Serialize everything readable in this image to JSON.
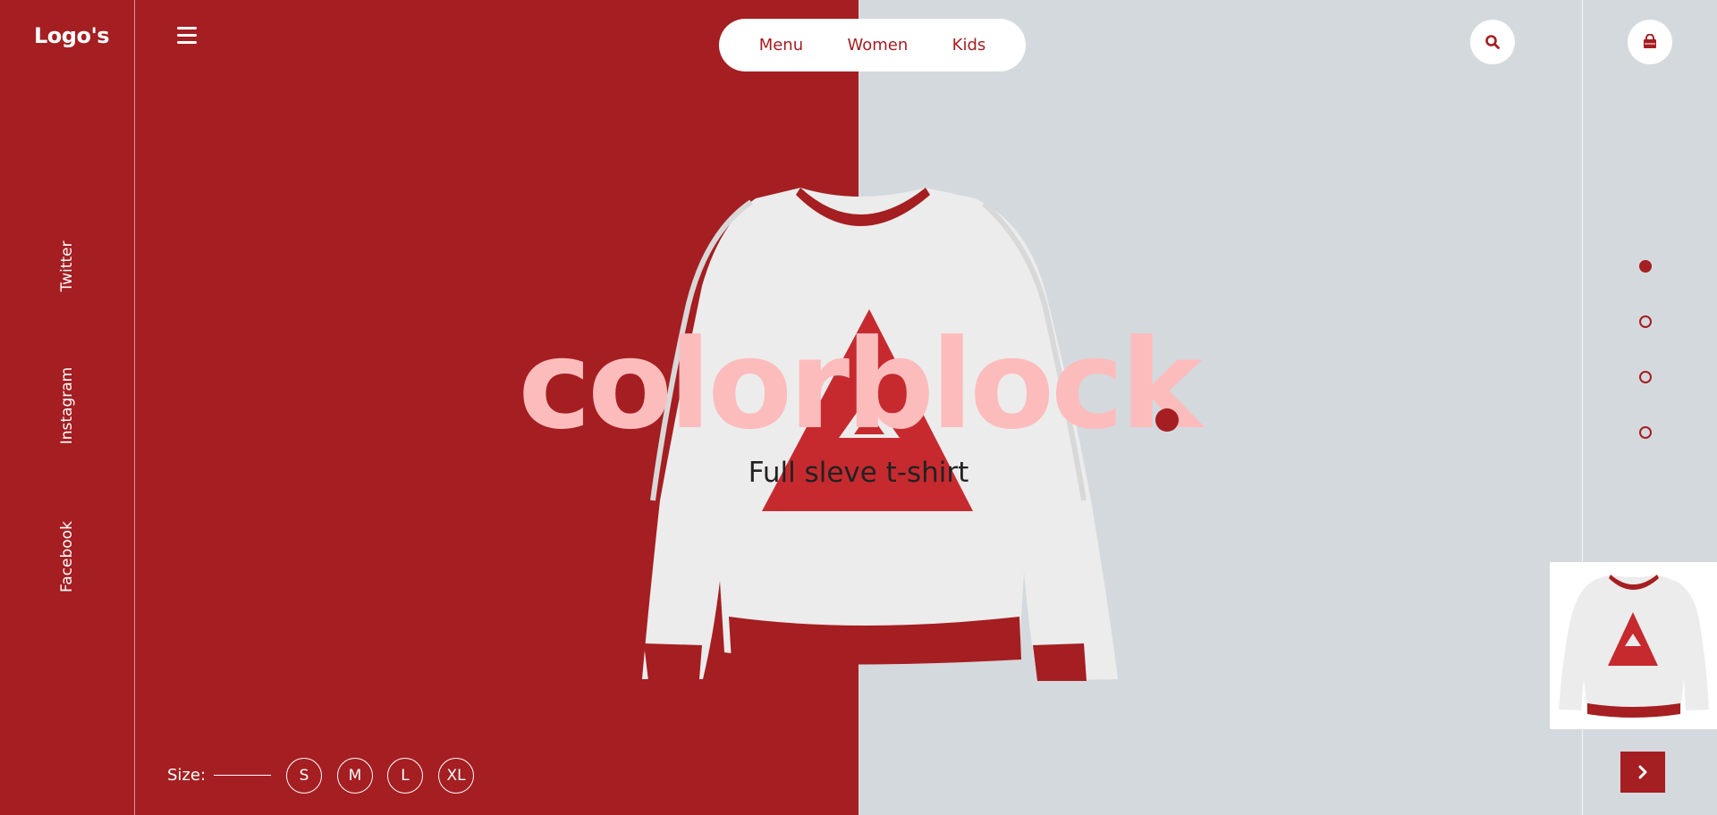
{
  "brand": {
    "logo_text": "Logo's"
  },
  "social": [
    {
      "label": "Twitter"
    },
    {
      "label": "Instagram"
    },
    {
      "label": "Facebook"
    }
  ],
  "nav": {
    "items": [
      {
        "label": "Menu"
      },
      {
        "label": "Women"
      },
      {
        "label": "Kids"
      }
    ]
  },
  "header_icons": {
    "search": "search-icon",
    "cart": "shopping-bag-icon",
    "menu": "hamburger-icon"
  },
  "hero": {
    "title": "colorblock",
    "subtitle": "Full sleve t-shirt"
  },
  "pager": {
    "count": 4,
    "active_index": 0
  },
  "sizes": {
    "label": "Size:",
    "options": [
      "S",
      "M",
      "L",
      "XL"
    ]
  },
  "colors": {
    "accent": "#a51e21",
    "title_pink": "#fdbcbc",
    "grey_bg": "#d4d9de",
    "white": "#ffffff"
  }
}
